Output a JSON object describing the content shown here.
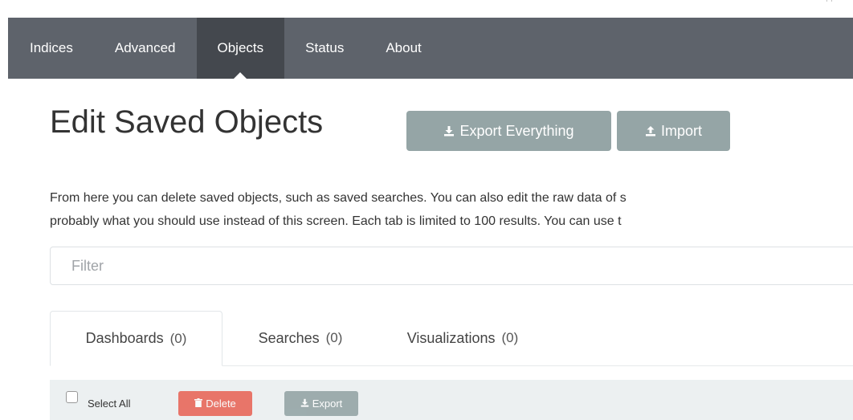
{
  "nav": {
    "items": [
      {
        "label": "Indices"
      },
      {
        "label": "Advanced"
      },
      {
        "label": "Objects"
      },
      {
        "label": "Status"
      },
      {
        "label": "About"
      }
    ],
    "active": "Objects"
  },
  "header": {
    "title": "Edit Saved Objects",
    "export_everything_label": "Export Everything",
    "import_label": "Import"
  },
  "description": {
    "line1": "From here you can delete saved objects, such as saved searches. You can also edit the raw data of s",
    "line2": "probably what you should use instead of this screen. Each tab is limited to 100 results. You can use t"
  },
  "filter": {
    "placeholder": "Filter",
    "value": ""
  },
  "tabs": [
    {
      "label": "Dashboards",
      "count": "(0)"
    },
    {
      "label": "Searches",
      "count": "(0)"
    },
    {
      "label": "Visualizations",
      "count": "(0)"
    }
  ],
  "toolbar": {
    "select_all_label": "Select All",
    "delete_label": "Delete",
    "export_label": "Export"
  },
  "colors": {
    "nav_bg": "#5e636b",
    "nav_active_bg": "#44484e",
    "button_bg": "#95a5a6",
    "delete_bg": "#e74c3c",
    "toolbar_bg": "#ecf0f1"
  },
  "icons": {
    "export": "download-icon",
    "import": "upload-icon",
    "delete": "trash-icon"
  }
}
